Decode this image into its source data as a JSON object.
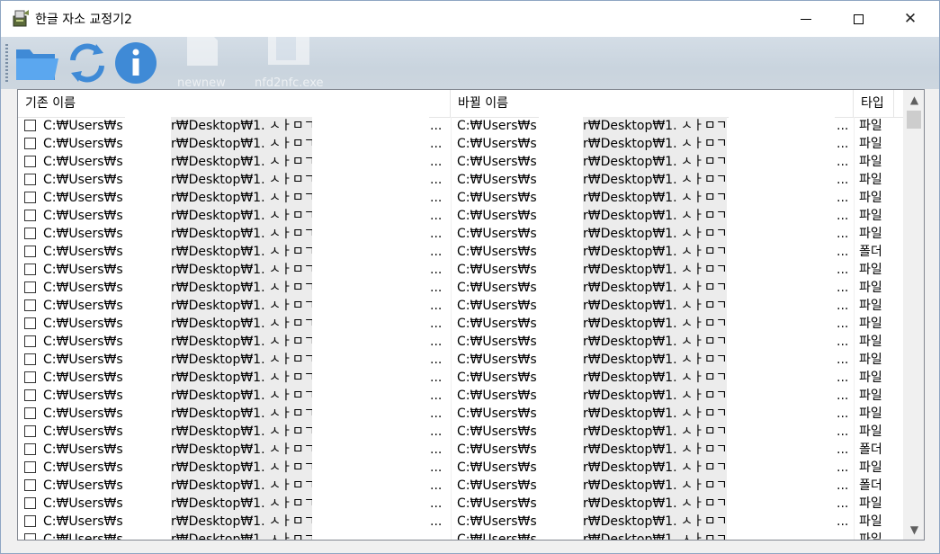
{
  "window": {
    "title": "한글 자소 교정기2",
    "close_glyph": "✕"
  },
  "desktop_bg": {
    "labels": [
      "newnew",
      "nfd2nfc.exe"
    ]
  },
  "columns": {
    "original": "기존 이름",
    "new": "바뀔 이름",
    "type": "타입"
  },
  "row_text": {
    "orig_prefix": "C:₩Users₩s",
    "orig_middle": "r₩Desktop₩1. ㅅㅏㅁㄱ",
    "new_prefix": "C:₩Users₩s",
    "new_middle": "r₩Desktop₩1. ㅅㅏㅁㄱ",
    "ellipsis": "..."
  },
  "rows": [
    {
      "type": "파일"
    },
    {
      "type": "파일"
    },
    {
      "type": "파일"
    },
    {
      "type": "파일"
    },
    {
      "type": "파일"
    },
    {
      "type": "파일"
    },
    {
      "type": "파일"
    },
    {
      "type": "폴더"
    },
    {
      "type": "파일"
    },
    {
      "type": "파일"
    },
    {
      "type": "파일"
    },
    {
      "type": "파일"
    },
    {
      "type": "파일"
    },
    {
      "type": "파일"
    },
    {
      "type": "파일"
    },
    {
      "type": "파일"
    },
    {
      "type": "파일"
    },
    {
      "type": "파일"
    },
    {
      "type": "폴더"
    },
    {
      "type": "파일"
    },
    {
      "type": "폴더"
    },
    {
      "type": "파일"
    },
    {
      "type": "파일"
    },
    {
      "type": "파일"
    }
  ],
  "scrollbar": {
    "up": "▲",
    "down": "▼"
  }
}
